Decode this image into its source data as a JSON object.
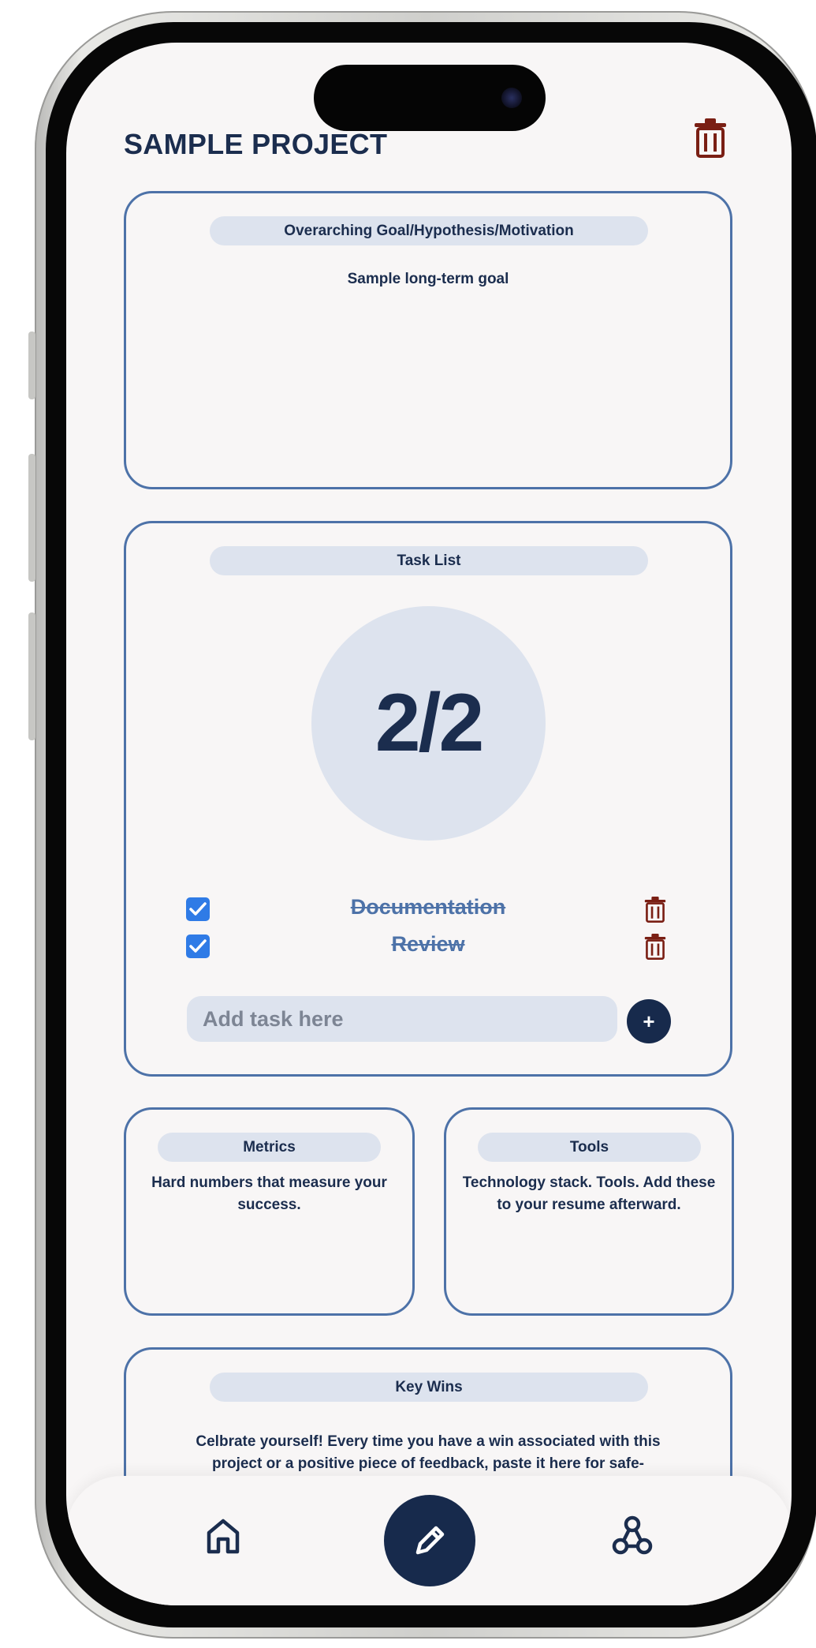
{
  "project": {
    "title": "SAMPLE PROJECT"
  },
  "goal_card": {
    "header": "Overarching Goal/Hypothesis/Motivation",
    "text": "Sample long-term goal"
  },
  "task_card": {
    "header": "Task List",
    "progress": "2/2",
    "tasks": [
      {
        "label": "Documentation",
        "completed": true
      },
      {
        "label": "Review",
        "completed": true
      }
    ],
    "add_placeholder": "Add task here",
    "add_button_label": "+"
  },
  "metrics_card": {
    "header": "Metrics",
    "text": "Hard numbers that measure your success."
  },
  "tools_card": {
    "header": "Tools",
    "text": "Technology stack. Tools. Add these to your resume afterward."
  },
  "wins_card": {
    "header": "Key Wins",
    "text": "Celbrate yourself! Every time you have a win associated with this project or a positive piece of feedback, paste it here for safe-"
  },
  "nav": {
    "items": [
      "home-icon",
      "pencil-icon",
      "network-icon"
    ]
  },
  "colors": {
    "navy": "#1b2d4e",
    "card_border": "#4d72a8",
    "pill_background": "#dde3ee",
    "delete_red": "#7a1f14",
    "checkbox_blue": "#2f7be6",
    "screen_background": "#f8f6f6"
  }
}
